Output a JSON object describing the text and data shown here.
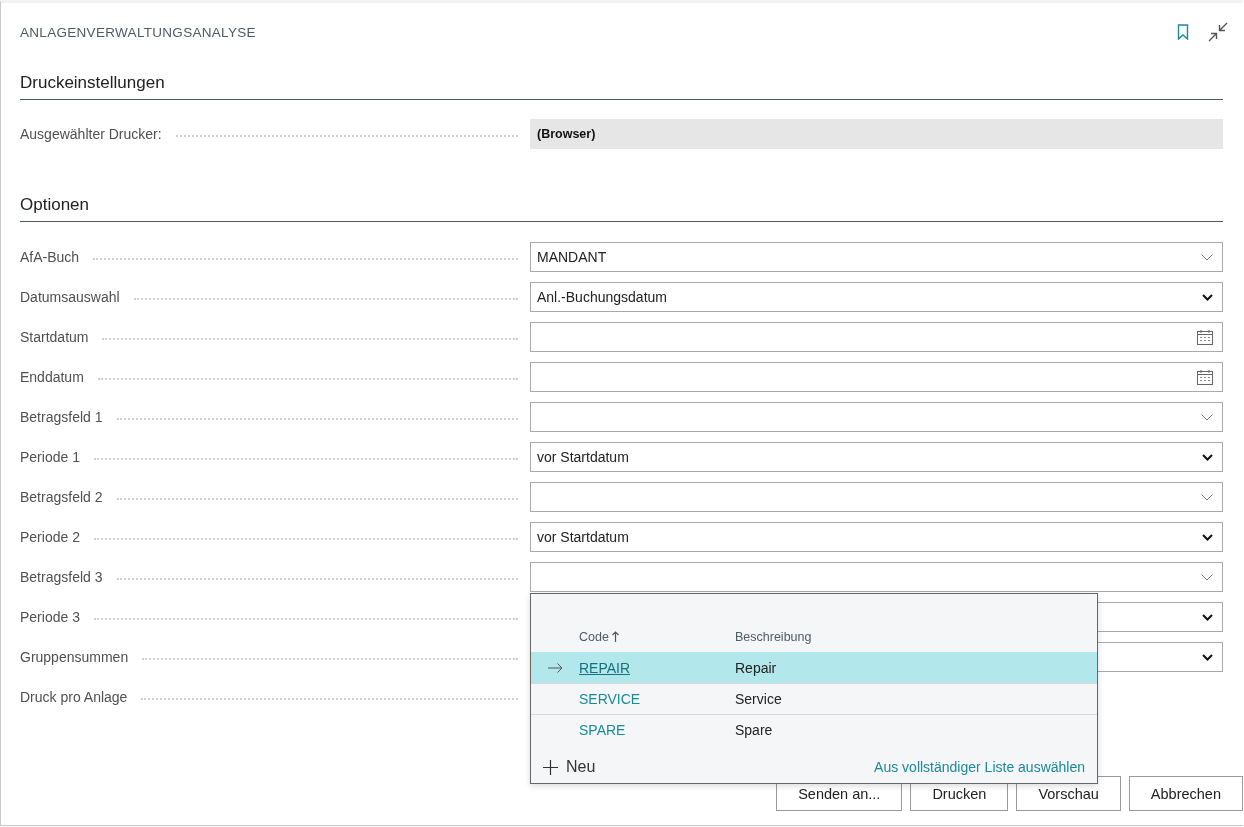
{
  "window": {
    "title": "ANLAGENVERWALTUNGSANALYSE"
  },
  "print_settings": {
    "heading": "Druckeinstellungen",
    "printer_label": "Ausgewählter Drucker:",
    "printer_value": "(Browser)"
  },
  "options": {
    "heading": "Optionen",
    "fields": [
      {
        "label": "AfA-Buch",
        "kind": "lookup",
        "value": "MANDANT"
      },
      {
        "label": "Datumsauswahl",
        "kind": "select",
        "value": "Anl.-Buchungsdatum"
      },
      {
        "label": "Startdatum",
        "kind": "date"
      },
      {
        "label": "Enddatum",
        "kind": "date"
      },
      {
        "label": "Betragsfeld 1",
        "kind": "lookup"
      },
      {
        "label": "Periode 1",
        "kind": "select",
        "value": "vor Startdatum"
      },
      {
        "label": "Betragsfeld 2",
        "kind": "lookup"
      },
      {
        "label": "Periode 2",
        "kind": "select",
        "value": "vor Startdatum"
      },
      {
        "label": "Betragsfeld 3",
        "kind": "lookup",
        "dropdown": {
          "columns": [
            {
              "label": "Code",
              "sorted": true
            },
            {
              "label": "Beschreibung",
              "sorted": false
            }
          ],
          "rows": [
            {
              "code": "REPAIR",
              "description": "Repair",
              "selected": true
            },
            {
              "code": "SERVICE",
              "description": "Service",
              "selected": false
            },
            {
              "code": "SPARE",
              "description": "Spare",
              "selected": false
            }
          ],
          "new_label": "Neu",
          "full_list_link": "Aus vollständiger Liste auswählen"
        }
      },
      {
        "label": "Periode 3",
        "kind": "select"
      },
      {
        "label": "Gruppensummen",
        "kind": "select"
      },
      {
        "label": "Druck pro Anlage",
        "kind": "none"
      }
    ]
  },
  "buttons": [
    "Senden an...",
    "Drucken",
    "Vorschau",
    "Abbrechen"
  ]
}
